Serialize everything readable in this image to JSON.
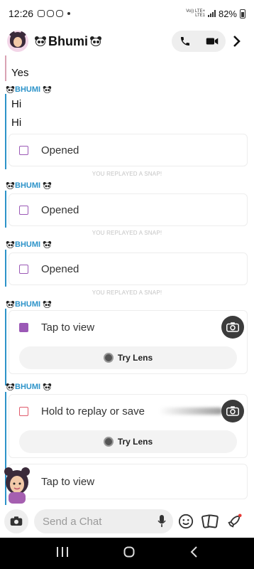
{
  "status_bar": {
    "time": "12:26",
    "network": "Vo)) LTE+ LTE1",
    "battery": "82%"
  },
  "header": {
    "contact_name": "Bhumi"
  },
  "messages": {
    "yes": "Yes",
    "sender_1": "BHUMI",
    "hi_1": "Hi",
    "hi_2": "Hi",
    "opened_1": "Opened",
    "replayed_1": "YOU REPLAYED A SNAP!",
    "sender_2": "BHUMI",
    "opened_2": "Opened",
    "replayed_2": "YOU REPLAYED A SNAP!",
    "sender_3": "BHUMI",
    "opened_3": "Opened",
    "replayed_3": "YOU REPLAYED A SNAP!",
    "sender_4": "BHUMI",
    "tap_to_view_1": "Tap to view",
    "try_lens_1": "Try Lens",
    "sender_5": "BHUMI",
    "hold_replay": "Hold to replay or save",
    "try_lens_2": "Try Lens",
    "tap_to_view_2": "Tap to view"
  },
  "composer": {
    "placeholder": "Send a Chat"
  },
  "colors": {
    "accent_blue": "#2c93c9",
    "snap_purple": "#9b59b6",
    "snap_red": "#e05a6b"
  },
  "icons": [
    "camera-icon",
    "mic-icon",
    "smiley-icon",
    "sticker-icon",
    "rocket-icon",
    "phone-icon",
    "video-icon",
    "chevron-right-icon"
  ]
}
